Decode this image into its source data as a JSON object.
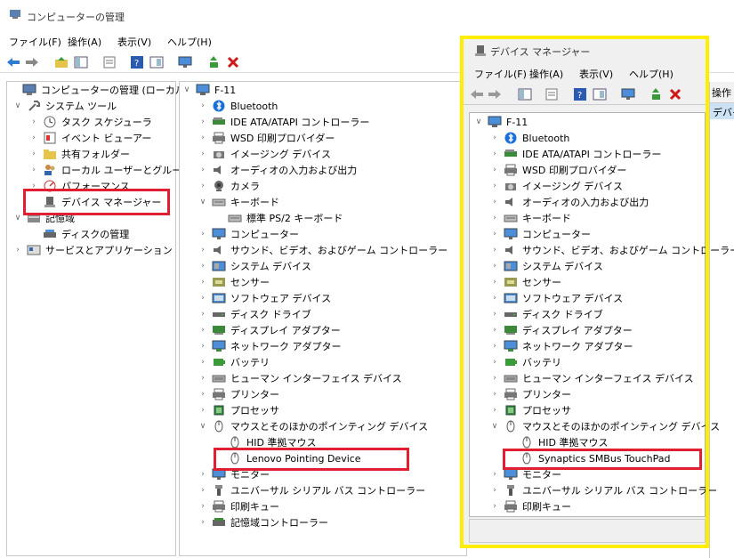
{
  "window": {
    "title": "コンピューターの管理"
  },
  "menu": [
    "ファイル(F)",
    "操作(A)",
    "表示(V)",
    "ヘルプ(H)"
  ],
  "left_tree": [
    {
      "label": "コンピューターの管理 (ローカル)",
      "icon": "computer-mgmt-icon"
    },
    {
      "label": "システム ツール",
      "icon": "tools-icon"
    },
    {
      "label": "タスク スケジューラ",
      "icon": "clock-icon"
    },
    {
      "label": "イベント ビューアー",
      "icon": "event-viewer-icon"
    },
    {
      "label": "共有フォルダー",
      "icon": "shared-folder-icon"
    },
    {
      "label": "ローカル ユーザーとグループ",
      "icon": "users-icon"
    },
    {
      "label": "パフォーマンス",
      "icon": "performance-icon"
    },
    {
      "label": "デバイス マネージャー",
      "icon": "device-manager-icon"
    },
    {
      "label": "記憶域",
      "icon": "storage-icon"
    },
    {
      "label": "ディスクの管理",
      "icon": "disk-mgmt-icon"
    },
    {
      "label": "サービスとアプリケーション",
      "icon": "services-icon"
    }
  ],
  "center_tree": [
    {
      "label": "F-11",
      "icon": "computer-icon"
    },
    {
      "label": "Bluetooth",
      "icon": "bluetooth-icon"
    },
    {
      "label": "IDE ATA/ATAPI コントローラー",
      "icon": "ide-controller-icon"
    },
    {
      "label": "WSD 印刷プロバイダー",
      "icon": "printer-icon"
    },
    {
      "label": "イメージング デバイス",
      "icon": "camera-icon"
    },
    {
      "label": "オーディオの入力および出力",
      "icon": "speaker-icon"
    },
    {
      "label": "カメラ",
      "icon": "webcam-icon"
    },
    {
      "label": "キーボード",
      "icon": "keyboard-icon"
    },
    {
      "label": "標準 PS/2 キーボード",
      "icon": "keyboard-icon"
    },
    {
      "label": "コンピューター",
      "icon": "monitor-icon"
    },
    {
      "label": "サウンド、ビデオ、およびゲーム コントローラー",
      "icon": "speaker-icon"
    },
    {
      "label": "システム デバイス",
      "icon": "system-device-icon"
    },
    {
      "label": "センサー",
      "icon": "sensor-icon"
    },
    {
      "label": "ソフトウェア デバイス",
      "icon": "software-device-icon"
    },
    {
      "label": "ディスク ドライブ",
      "icon": "disk-drive-icon"
    },
    {
      "label": "ディスプレイ アダプター",
      "icon": "display-adapter-icon"
    },
    {
      "label": "ネットワーク アダプター",
      "icon": "network-adapter-icon"
    },
    {
      "label": "バッテリ",
      "icon": "battery-icon"
    },
    {
      "label": "ヒューマン インターフェイス デバイス",
      "icon": "hid-icon"
    },
    {
      "label": "プリンター",
      "icon": "printer-icon"
    },
    {
      "label": "プロセッサ",
      "icon": "processor-icon"
    },
    {
      "label": "マウスとそのほかのポインティング デバイス",
      "icon": "mouse-icon"
    },
    {
      "label": "HID 準拠マウス",
      "icon": "mouse-icon"
    },
    {
      "label": "Lenovo Pointing Device",
      "icon": "mouse-icon"
    },
    {
      "label": "モニター",
      "icon": "monitor-icon"
    },
    {
      "label": "ユニバーサル シリアル バス コントローラー",
      "icon": "usb-icon"
    },
    {
      "label": "印刷キュー",
      "icon": "printer-icon"
    },
    {
      "label": "記憶域コントローラー",
      "icon": "storage-controller-icon"
    }
  ],
  "overlay": {
    "title": "デバイス マネージャー",
    "menu": [
      "ファイル(F)",
      "操作(A)",
      "表示(V)",
      "ヘルプ(H)"
    ],
    "tree": [
      {
        "label": "F-11",
        "icon": "computer-icon"
      },
      {
        "label": "Bluetooth",
        "icon": "bluetooth-icon"
      },
      {
        "label": "IDE ATA/ATAPI コントローラー",
        "icon": "ide-controller-icon"
      },
      {
        "label": "WSD 印刷プロバイダー",
        "icon": "printer-icon"
      },
      {
        "label": "イメージング デバイス",
        "icon": "camera-icon"
      },
      {
        "label": "オーディオの入力および出力",
        "icon": "speaker-icon"
      },
      {
        "label": "キーボード",
        "icon": "keyboard-icon"
      },
      {
        "label": "コンピューター",
        "icon": "monitor-icon"
      },
      {
        "label": "サウンド、ビデオ、およびゲーム コントローラー",
        "icon": "speaker-icon"
      },
      {
        "label": "システム デバイス",
        "icon": "system-device-icon"
      },
      {
        "label": "センサー",
        "icon": "sensor-icon"
      },
      {
        "label": "ソフトウェア デバイス",
        "icon": "software-device-icon"
      },
      {
        "label": "ディスク ドライブ",
        "icon": "disk-drive-icon"
      },
      {
        "label": "ディスプレイ アダプター",
        "icon": "display-adapter-icon"
      },
      {
        "label": "ネットワーク アダプター",
        "icon": "network-adapter-icon"
      },
      {
        "label": "バッテリ",
        "icon": "battery-icon"
      },
      {
        "label": "ヒューマン インターフェイス デバイス",
        "icon": "hid-icon"
      },
      {
        "label": "プリンター",
        "icon": "printer-icon"
      },
      {
        "label": "プロセッサ",
        "icon": "processor-icon"
      },
      {
        "label": "マウスとそのほかのポインティング デバイス",
        "icon": "mouse-icon"
      },
      {
        "label": "HID 準拠マウス",
        "icon": "mouse-icon"
      },
      {
        "label": "Synaptics SMBus TouchPad",
        "icon": "mouse-icon"
      },
      {
        "label": "モニター",
        "icon": "monitor-icon"
      },
      {
        "label": "ユニバーサル シリアル バス コントローラー",
        "icon": "usb-icon"
      },
      {
        "label": "印刷キュー",
        "icon": "printer-icon"
      }
    ]
  },
  "operations": {
    "header": "操作",
    "selected": "デバイ"
  },
  "colors": {
    "highlight_red": "#e02030",
    "highlight_yellow": "#ffee00",
    "selection": "#cde2f5"
  }
}
